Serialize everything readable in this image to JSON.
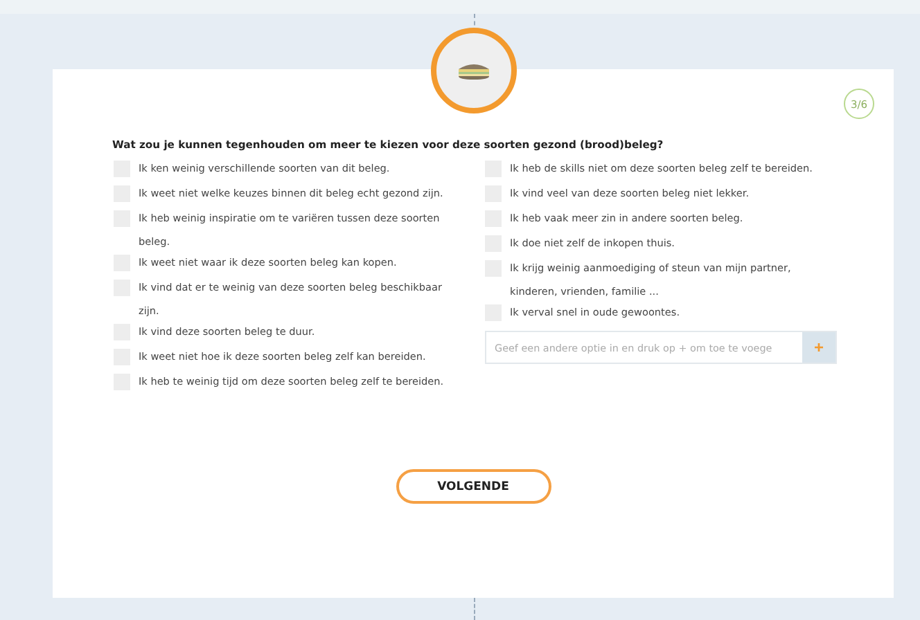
{
  "step": "3/6",
  "question": "Wat zou je kunnen tegenhouden om meer te kiezen voor deze soorten gezond (brood)beleg?",
  "columns": [
    [
      {
        "label": "Ik ken weinig verschillende soorten van dit beleg.",
        "checked": false
      },
      {
        "label": "Ik weet niet welke keuzes binnen dit beleg echt gezond zijn.",
        "checked": false
      },
      {
        "label": "Ik heb weinig inspiratie om te variëren tussen deze soorten beleg.",
        "checked": false
      },
      {
        "label": "Ik weet niet waar ik deze soorten beleg kan kopen.",
        "checked": false
      },
      {
        "label": "Ik vind dat er te weinig van deze soorten beleg beschikbaar zijn.",
        "checked": false
      },
      {
        "label": "Ik vind deze soorten beleg te duur.",
        "checked": false
      },
      {
        "label": "Ik weet niet hoe ik deze soorten beleg zelf kan bereiden.",
        "checked": false
      },
      {
        "label": "Ik heb te weinig tijd om deze soorten beleg zelf te bereiden.",
        "checked": false
      }
    ],
    [
      {
        "label": "Ik heb de skills niet om deze soorten beleg zelf te bereiden.",
        "checked": false
      },
      {
        "label": "Ik vind veel van deze soorten beleg niet lekker.",
        "checked": false
      },
      {
        "label": "Ik heb vaak meer zin in andere soorten beleg.",
        "checked": false
      },
      {
        "label": "Ik doe niet zelf de inkopen thuis.",
        "checked": false
      },
      {
        "label": "Ik krijg weinig aanmoediging of steun van mijn partner, kinderen, vrienden, familie ...",
        "checked": false
      },
      {
        "label": "Ik verval snel in oude gewoontes.",
        "checked": false
      }
    ]
  ],
  "other": {
    "placeholder": "Geef een andere optie in en druk op + om toe te voege",
    "button": "+"
  },
  "next_button": "VOLGENDE"
}
